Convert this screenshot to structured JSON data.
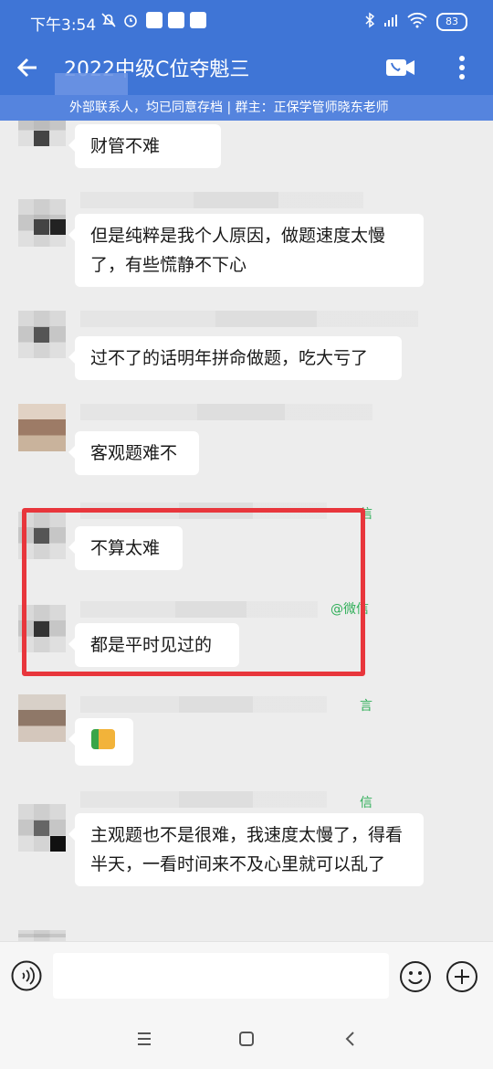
{
  "status_bar": {
    "time": "下午3:54",
    "battery": "83"
  },
  "header": {
    "title": "2022中级C位夺魁三",
    "notice": "外部联系人，均已同意存档 | 群主：正保学管师晓东老师"
  },
  "messages": [
    {
      "text": "财管不难"
    },
    {
      "text": "但是纯粹是我个人原因，做题速度太慢了，有些慌静不下心"
    },
    {
      "text": "过不了的话明年拼命做题，吃大亏了"
    },
    {
      "text": "客观题难不"
    },
    {
      "text": "不算太难"
    },
    {
      "text": "都是平时见过的"
    },
    {
      "text": ""
    },
    {
      "text": "主观题也不是很难，我速度太慢了，得看半天，一看时间来不及心里就可以乱了"
    }
  ],
  "source_tags": {
    "wechat_full": "@微信",
    "wechat_short": "信",
    "wechat_partial": "言"
  },
  "colors": {
    "header_bg": "#3f75d6",
    "highlight": "#e8363c",
    "wechat_green": "#2fae58"
  }
}
